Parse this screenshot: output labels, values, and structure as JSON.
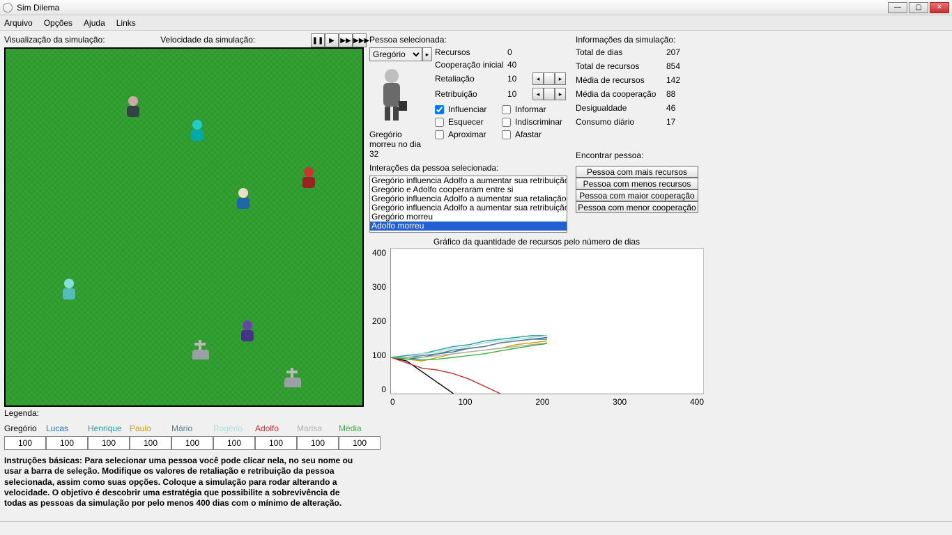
{
  "window": {
    "title": "Sim Dilema"
  },
  "menu": {
    "arquivo": "Arquivo",
    "opcoes": "Opções",
    "ajuda": "Ajuda",
    "links": "Links"
  },
  "left": {
    "vis_label": "Visualização da simulação:",
    "speed_label": "Velocidade da simulação:",
    "speed_buttons": {
      "pause": "❚❚",
      "play": "▶",
      "fast": "▶▶",
      "faster": "▶▶▶"
    },
    "legend_label": "Legenda:",
    "legend": [
      {
        "name": "Gregório",
        "color": "#000000",
        "value": "100"
      },
      {
        "name": "Lucas",
        "color": "#2b6fb0",
        "value": "100"
      },
      {
        "name": "Henrique",
        "color": "#1c9e9e",
        "value": "100"
      },
      {
        "name": "Paulo",
        "color": "#c6a100",
        "value": "100"
      },
      {
        "name": "Mário",
        "color": "#5a7a8a",
        "value": "100"
      },
      {
        "name": "Rogério",
        "color": "#a8e0d8",
        "value": "100"
      },
      {
        "name": "Adolfo",
        "color": "#c03030",
        "value": "100"
      },
      {
        "name": "Marisa",
        "color": "#b0b0b0",
        "value": "100"
      }
    ],
    "media_label": "Média",
    "media_color": "#3cb043",
    "media_value": "100",
    "instructions": "Instruções básicas: Para selecionar uma pessoa você pode clicar nela, no seu nome ou usar a barra de seleção. Modifique os valores de retaliação e retribuição da pessoa selecionada, assim como suas opções. Coloque a simulação para rodar alterando a velocidade. O objetivo é descobrir uma estratégia que possibilite a sobrevivência de todas as pessoas da simulação por pelo menos 400 dias com o mínimo de alteração."
  },
  "mid": {
    "selected_label": "Pessoa selecionada:",
    "selected_person": "Gregório",
    "stats": {
      "recursos_label": "Recursos",
      "recursos": "0",
      "coop_label": "Cooperação inicial",
      "coop": "40",
      "retal_label": "Retaliação",
      "retal": "10",
      "retrib_label": "Retribuição",
      "retrib": "10"
    },
    "checks": {
      "influenciar": "Influenciar",
      "informar": "Informar",
      "esquecer": "Esquecer",
      "indiscriminar": "Indiscriminar",
      "aproximar": "Aproximar",
      "afastar": "Afastar"
    },
    "death_note": "Gregório morreu no dia 32",
    "interactions_label": "Interações da pessoa selecionada:",
    "interactions": [
      "Gregório influencia Adolfo a aumentar sua retribuição",
      "Gregório e Adolfo cooperaram entre si",
      "Gregório influencia Adolfo a aumentar sua retaliação",
      "Gregório influencia Adolfo a aumentar sua retribuição",
      "Gregório morreu",
      "Adolfo morreu"
    ],
    "chart_title": "Gráfico da quantidade de recursos pelo número de dias"
  },
  "right": {
    "info_label": "Informações da simulação:",
    "info": {
      "dias_label": "Total de dias",
      "dias": "207",
      "recursos_label": "Total de recursos",
      "recursos": "854",
      "media_rec_label": "Média de recursos",
      "media_rec": "142",
      "media_coop_label": "Média da cooperação",
      "media_coop": "88",
      "desig_label": "Desigualdade",
      "desig": "46",
      "consumo_label": "Consumo diário",
      "consumo": "17"
    },
    "find_label": "Encontrar pessoa:",
    "find": {
      "mais": "Pessoa com mais recursos",
      "menos": "Pessoa com menos recursos",
      "maior_coop": "Pessoa com maior cooperação",
      "menor_coop": "Pessoa com menor cooperação"
    }
  },
  "chart_data": {
    "type": "line",
    "title": "Gráfico da quantidade de recursos pelo número de dias",
    "xlabel": "",
    "ylabel": "",
    "xlim": [
      0,
      400
    ],
    "ylim": [
      0,
      400
    ],
    "xticks": [
      0,
      100,
      200,
      300,
      400
    ],
    "yticks": [
      0,
      100,
      200,
      300,
      400
    ],
    "x": [
      0,
      20,
      40,
      60,
      80,
      100,
      120,
      140,
      160,
      180,
      200
    ],
    "series": [
      {
        "name": "Gregório",
        "color": "#000000",
        "values": [
          100,
          90,
          60,
          30,
          0,
          null,
          null,
          null,
          null,
          null,
          null
        ]
      },
      {
        "name": "Lucas",
        "color": "#2b6fb0",
        "values": [
          100,
          95,
          100,
          110,
          115,
          125,
          130,
          140,
          145,
          150,
          155
        ]
      },
      {
        "name": "Henrique",
        "color": "#1c9e9e",
        "values": [
          100,
          105,
          110,
          120,
          130,
          135,
          145,
          150,
          155,
          160,
          160
        ]
      },
      {
        "name": "Paulo",
        "color": "#c6a100",
        "values": [
          100,
          95,
          90,
          100,
          110,
          115,
          120,
          125,
          135,
          140,
          145
        ]
      },
      {
        "name": "Mário",
        "color": "#5a7a8a",
        "values": [
          100,
          100,
          105,
          110,
          120,
          125,
          130,
          140,
          145,
          150,
          150
        ]
      },
      {
        "name": "Rogério",
        "color": "#a8e0d8",
        "values": [
          100,
          100,
          110,
          115,
          125,
          130,
          140,
          145,
          150,
          155,
          160
        ]
      },
      {
        "name": "Adolfo",
        "color": "#c03030",
        "values": [
          100,
          85,
          70,
          65,
          55,
          40,
          20,
          0,
          null,
          null,
          null
        ]
      },
      {
        "name": "Marisa",
        "color": "#b0b0b0",
        "values": [
          100,
          100,
          100,
          105,
          110,
          115,
          120,
          125,
          130,
          135,
          140
        ]
      },
      {
        "name": "Média",
        "color": "#3cb043",
        "values": [
          100,
          96,
          93,
          95,
          100,
          105,
          110,
          118,
          125,
          132,
          138
        ]
      }
    ]
  }
}
